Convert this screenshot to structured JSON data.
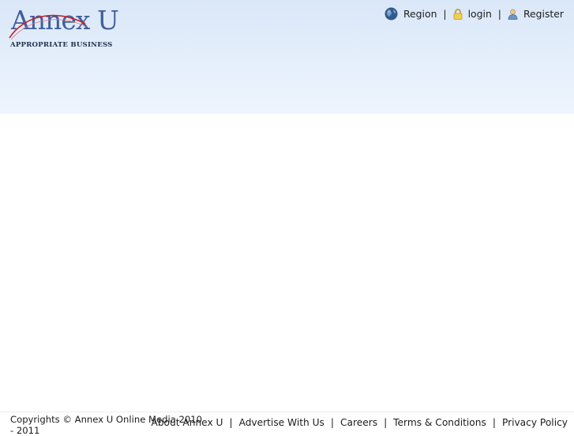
{
  "header": {
    "logo": {
      "text": "Annex U",
      "tagline": "APPROPRIATE BUSINESS"
    },
    "links": [
      {
        "label": "Region",
        "icon": "globe-icon"
      },
      {
        "label": "login",
        "icon": "lock-icon"
      },
      {
        "label": "Register",
        "icon": "user-icon"
      }
    ],
    "separator": "|"
  },
  "footer": {
    "copyright": "Copyrights © Annex U Online Media 2010 - 2011",
    "links": [
      "About Annex U",
      "Advertise With Us",
      "Careers",
      "Terms & Conditions",
      "Privacy Policy"
    ],
    "separator": "|"
  },
  "colors": {
    "header_gradient_top": "#dae7f8",
    "header_gradient_bottom": "#eef4fd",
    "logo_blue": "#3f5f9a",
    "logo_swoosh_red": "#c8202a",
    "text": "#1c1c1c"
  }
}
